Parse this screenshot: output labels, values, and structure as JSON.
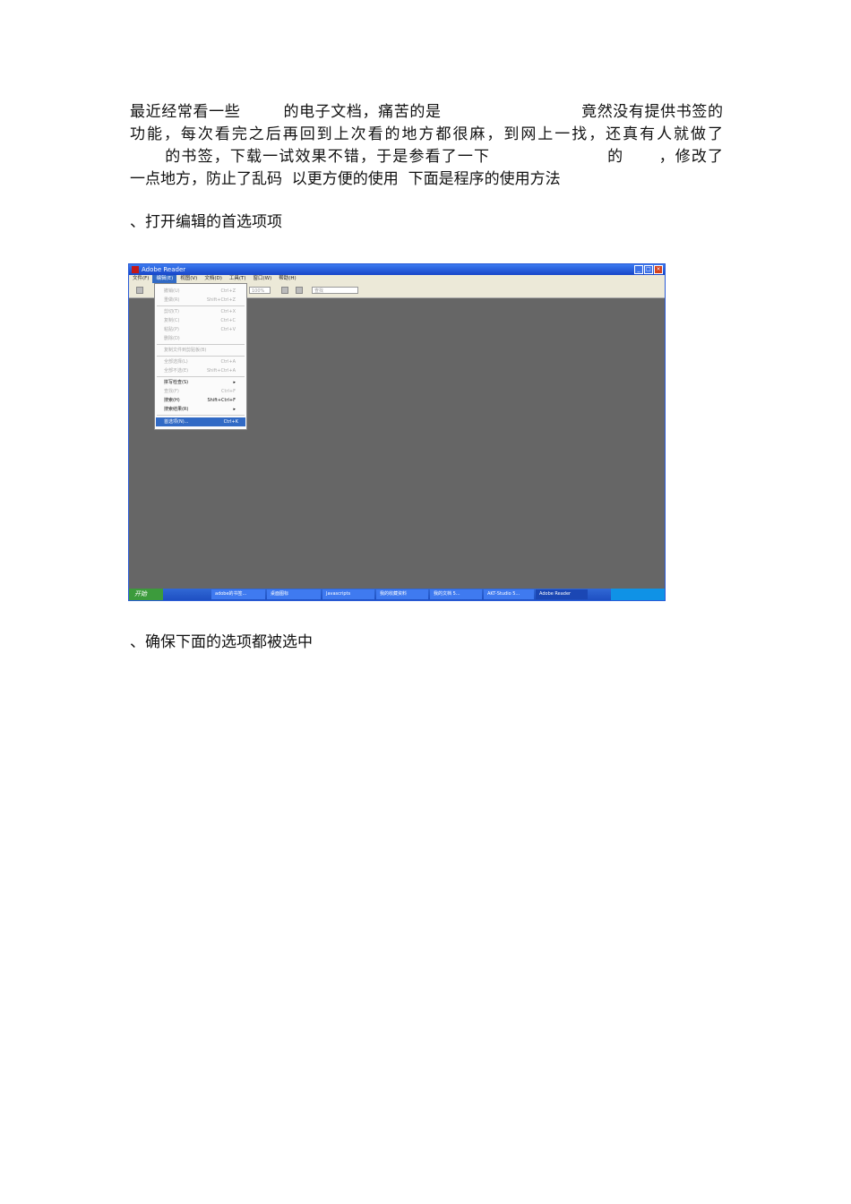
{
  "paragraph": {
    "lines": [
      "最近经常看一些        的电子文档，痛苦的是                          竟然没有提供书签的",
      "功能，每次看完之后再回到上次看的地方都很麻，到网上一找，还真有人就做了",
      "      的书签，下载一试效果不错，于是参看了一下                    的      ，修改了",
      "一点地方，防止了乱码  以更方便的使用  下面是程序的使用方法"
    ]
  },
  "steps": {
    "step1": "、打开编辑的首选项项",
    "step2": "、确保下面的选项都被选中"
  },
  "screenshot": {
    "title": "Adobe Reader",
    "menu": [
      "文件(F)",
      "编辑(E)",
      "视图(V)",
      "文档(D)",
      "工具(T)",
      "窗口(W)",
      "帮助(H)"
    ],
    "zoom": "100%",
    "find": "查找",
    "edit_menu": [
      {
        "label": "撤销(U)",
        "shortcut": "Ctrl+Z",
        "enabled": false
      },
      {
        "label": "重做(R)",
        "shortcut": "Shift+Ctrl+Z",
        "enabled": false
      },
      {
        "label": "剪切(T)",
        "shortcut": "Ctrl+X",
        "enabled": false
      },
      {
        "label": "复制(C)",
        "shortcut": "Ctrl+C",
        "enabled": false
      },
      {
        "label": "粘贴(P)",
        "shortcut": "Ctrl+V",
        "enabled": false
      },
      {
        "label": "删除(D)",
        "shortcut": "",
        "enabled": false
      },
      {
        "label": "复制文件到剪贴板(B)",
        "shortcut": "",
        "enabled": false
      },
      {
        "label": "全部选择(L)",
        "shortcut": "Ctrl+A",
        "enabled": false
      },
      {
        "label": "全部不选(E)",
        "shortcut": "Shift+Ctrl+A",
        "enabled": false
      },
      {
        "label": "拼写检查(S)",
        "shortcut": "▸",
        "enabled": true
      },
      {
        "label": "查找(F)",
        "shortcut": "Ctrl+F",
        "enabled": false
      },
      {
        "label": "搜索(H)",
        "shortcut": "Shift+Ctrl+F",
        "enabled": true
      },
      {
        "label": "搜索结果(R)",
        "shortcut": "▸",
        "enabled": true
      },
      {
        "label": "首选项(N)...",
        "shortcut": "Ctrl+K",
        "enabled": true,
        "selected": true
      }
    ],
    "taskbar": {
      "start": "开始",
      "buttons": [
        "adobe的书签...",
        "桌面图标",
        "Javascripts",
        "我的收藏资料",
        "我的文档 5...",
        "AKT-Studio 5...",
        "Adobe Reader"
      ]
    }
  }
}
